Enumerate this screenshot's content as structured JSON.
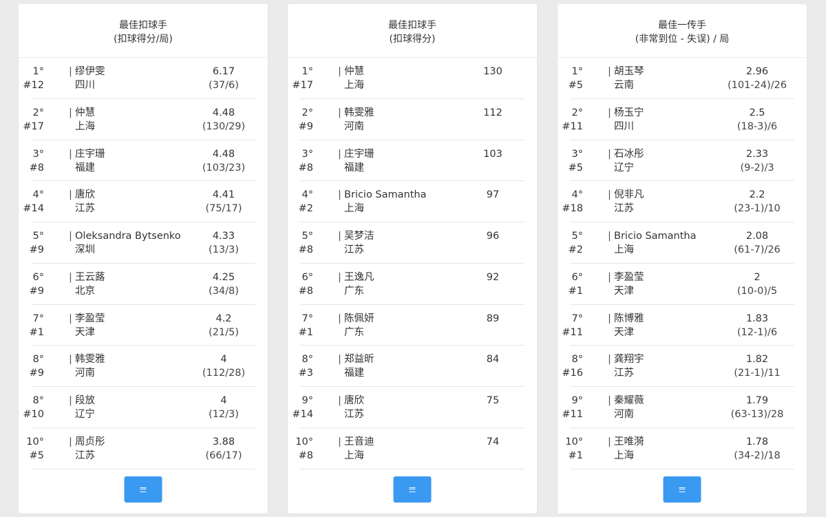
{
  "cards": [
    {
      "title": "最佳扣球手",
      "subtitle": "(扣球得分/局)",
      "rows": [
        {
          "rank": "1°",
          "number": "#12",
          "name": "缪伊雯",
          "team": "四川",
          "value": "6.17",
          "detail": "(37/6)"
        },
        {
          "rank": "2°",
          "number": "#17",
          "name": "仲慧",
          "team": "上海",
          "value": "4.48",
          "detail": "(130/29)"
        },
        {
          "rank": "3°",
          "number": "#8",
          "name": "庄宇珊",
          "team": "福建",
          "value": "4.48",
          "detail": "(103/23)"
        },
        {
          "rank": "4°",
          "number": "#14",
          "name": "唐欣",
          "team": "江苏",
          "value": "4.41",
          "detail": "(75/17)"
        },
        {
          "rank": "5°",
          "number": "#9",
          "name": "Oleksandra Bytsenko",
          "team": "深圳",
          "value": "4.33",
          "detail": "(13/3)"
        },
        {
          "rank": "6°",
          "number": "#9",
          "name": "王云蕗",
          "team": "北京",
          "value": "4.25",
          "detail": "(34/8)"
        },
        {
          "rank": "7°",
          "number": "#1",
          "name": "李盈莹",
          "team": "天津",
          "value": "4.2",
          "detail": "(21/5)"
        },
        {
          "rank": "8°",
          "number": "#9",
          "name": "韩雯雅",
          "team": "河南",
          "value": "4",
          "detail": "(112/28)"
        },
        {
          "rank": "8°",
          "number": "#10",
          "name": "段放",
          "team": "辽宁",
          "value": "4",
          "detail": "(12/3)"
        },
        {
          "rank": "10°",
          "number": "#5",
          "name": "周贞彤",
          "team": "江苏",
          "value": "3.88",
          "detail": "(66/17)"
        }
      ]
    },
    {
      "title": "最佳扣球手",
      "subtitle": "(扣球得分)",
      "rows": [
        {
          "rank": "1°",
          "number": "#17",
          "name": "仲慧",
          "team": "上海",
          "value": "130",
          "detail": ""
        },
        {
          "rank": "2°",
          "number": "#9",
          "name": "韩雯雅",
          "team": "河南",
          "value": "112",
          "detail": ""
        },
        {
          "rank": "3°",
          "number": "#8",
          "name": "庄宇珊",
          "team": "福建",
          "value": "103",
          "detail": ""
        },
        {
          "rank": "4°",
          "number": "#2",
          "name": "Bricio Samantha",
          "team": "上海",
          "value": "97",
          "detail": ""
        },
        {
          "rank": "5°",
          "number": "#8",
          "name": "吴梦洁",
          "team": "江苏",
          "value": "96",
          "detail": ""
        },
        {
          "rank": "6°",
          "number": "#8",
          "name": "王逸凡",
          "team": "广东",
          "value": "92",
          "detail": ""
        },
        {
          "rank": "7°",
          "number": "#1",
          "name": "陈佩妍",
          "team": "广东",
          "value": "89",
          "detail": ""
        },
        {
          "rank": "8°",
          "number": "#3",
          "name": "郑益昕",
          "team": "福建",
          "value": "84",
          "detail": ""
        },
        {
          "rank": "9°",
          "number": "#14",
          "name": "唐欣",
          "team": "江苏",
          "value": "75",
          "detail": ""
        },
        {
          "rank": "10°",
          "number": "#8",
          "name": "王音迪",
          "team": "上海",
          "value": "74",
          "detail": ""
        }
      ]
    },
    {
      "title": "最佳一传手",
      "subtitle": "(非常到位 - 失误) / 局",
      "rows": [
        {
          "rank": "1°",
          "number": "#5",
          "name": "胡玉琴",
          "team": "云南",
          "value": "2.96",
          "detail": "(101-24)/26"
        },
        {
          "rank": "2°",
          "number": "#11",
          "name": "杨玉宁",
          "team": "四川",
          "value": "2.5",
          "detail": "(18-3)/6"
        },
        {
          "rank": "3°",
          "number": "#5",
          "name": "石冰彤",
          "team": "辽宁",
          "value": "2.33",
          "detail": "(9-2)/3"
        },
        {
          "rank": "4°",
          "number": "#18",
          "name": "倪非凡",
          "team": "江苏",
          "value": "2.2",
          "detail": "(23-1)/10"
        },
        {
          "rank": "5°",
          "number": "#2",
          "name": "Bricio Samantha",
          "team": "上海",
          "value": "2.08",
          "detail": "(61-7)/26"
        },
        {
          "rank": "6°",
          "number": "#1",
          "name": "李盈莹",
          "team": "天津",
          "value": "2",
          "detail": "(10-0)/5"
        },
        {
          "rank": "7°",
          "number": "#11",
          "name": "陈博雅",
          "team": "天津",
          "value": "1.83",
          "detail": "(12-1)/6"
        },
        {
          "rank": "8°",
          "number": "#16",
          "name": "龚翔宇",
          "team": "江苏",
          "value": "1.82",
          "detail": "(21-1)/11"
        },
        {
          "rank": "9°",
          "number": "#11",
          "name": "秦耀薇",
          "team": "河南",
          "value": "1.79",
          "detail": "(63-13)/28"
        },
        {
          "rank": "10°",
          "number": "#1",
          "name": "王唯漪",
          "team": "上海",
          "value": "1.78",
          "detail": "(34-2)/18"
        }
      ]
    }
  ],
  "more_button": {
    "icon": "menu-icon",
    "color": "#3a99f0"
  }
}
